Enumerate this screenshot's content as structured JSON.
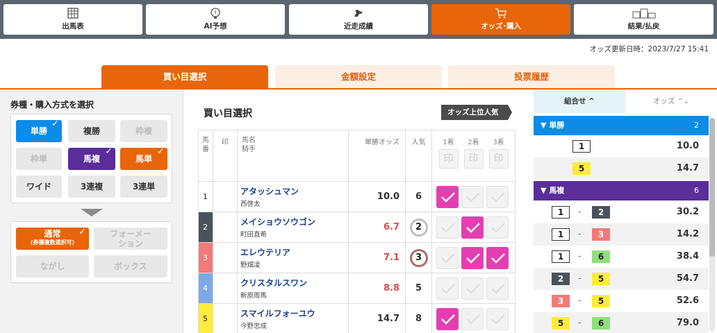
{
  "nav": [
    {
      "label": "出馬表",
      "icon": "table-icon"
    },
    {
      "label": "AI予想",
      "icon": "bulb-icon"
    },
    {
      "label": "近走成績",
      "icon": "horse-icon"
    },
    {
      "label": "オッズ･購入",
      "icon": "cart-icon",
      "active": true
    },
    {
      "label": "結果/払戻",
      "icon": "podium-icon"
    }
  ],
  "update": "オッズ更新日時：2023/7/27 15:41",
  "subtabs": [
    "買い目選択",
    "金額設定",
    "投票履歴"
  ],
  "left": {
    "title": "券種・購入方式を選択",
    "bet_types": [
      "単勝",
      "複勝",
      "枠複",
      "枠単",
      "馬複",
      "馬単",
      "ワイド",
      "3連複",
      "3連単"
    ],
    "methods": [
      "通常",
      "(券種複数選択可)",
      "フォーメー",
      "ション",
      "ながし",
      "ボックス"
    ]
  },
  "middle": {
    "title": "買い目選択",
    "badge": "オッズ上位人気",
    "headers": {
      "num1": "馬",
      "num2": "番",
      "mark": "印",
      "name1": "馬名",
      "name2": "騎手",
      "odds": "単勝オッズ",
      "pop": "人気",
      "pos": [
        "1着",
        "2着",
        "3着"
      ],
      "stamp": "印"
    },
    "rows": [
      {
        "num": "1",
        "horse": "アタッシュマン",
        "jockey": "西啓太",
        "odds": "10.0",
        "pop": "6"
      },
      {
        "num": "2",
        "horse": "メイショウソウゴン",
        "jockey": "町田直希",
        "odds": "6.7",
        "pop": "2"
      },
      {
        "num": "3",
        "horse": "エレウテリア",
        "jockey": "野畑凌",
        "odds": "7.1",
        "pop": "3"
      },
      {
        "num": "4",
        "horse": "クリスタルスワン",
        "jockey": "新原周馬",
        "odds": "8.8",
        "pop": "5"
      },
      {
        "num": "5",
        "horse": "スマイルフォーユウ",
        "jockey": "今野忠成",
        "odds": "14.7",
        "pop": "8"
      }
    ]
  },
  "right": {
    "tab_combo": "組合せ ^",
    "tab_odds": "オッズ ⌃⌄",
    "groups": [
      {
        "name": "単勝",
        "count": "2",
        "color": "#0c8be8"
      },
      {
        "name": "馬複",
        "count": "6",
        "color": "#5a2d99"
      }
    ],
    "tansho": [
      {
        "a": "1",
        "odds": "10.0"
      },
      {
        "a": "5",
        "odds": "14.7"
      }
    ],
    "umafuku": [
      {
        "a": "1",
        "b": "2",
        "odds": "30.2"
      },
      {
        "a": "1",
        "b": "3",
        "odds": "14.2"
      },
      {
        "a": "1",
        "b": "6",
        "odds": "38.4"
      },
      {
        "a": "2",
        "b": "5",
        "odds": "54.7"
      },
      {
        "a": "3",
        "b": "5",
        "odds": "52.6"
      },
      {
        "a": "5",
        "b": "6",
        "odds": "79.0"
      }
    ],
    "dash": "-"
  }
}
